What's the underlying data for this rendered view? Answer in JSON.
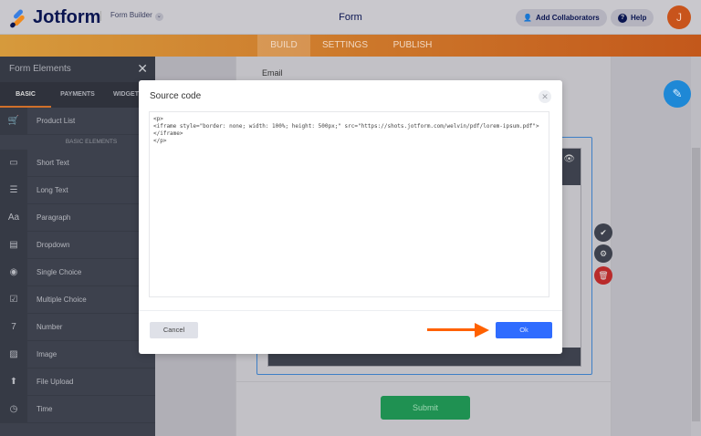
{
  "header": {
    "logo": "Jotform",
    "builder": "Form Builder",
    "title": "Form",
    "add_collaborators": "Add Collaborators",
    "help": "Help",
    "avatar": "J"
  },
  "nav": {
    "tabs": [
      "BUILD",
      "SETTINGS",
      "PUBLISH"
    ]
  },
  "sidebar": {
    "title": "Form Elements",
    "tabs": [
      "BASIC",
      "PAYMENTS",
      "WIDGETS"
    ],
    "product": {
      "label": "Product List",
      "icon": "🛒"
    },
    "section": "BASIC ELEMENTS",
    "items": [
      {
        "label": "Short Text",
        "icon": "▭"
      },
      {
        "label": "Long Text",
        "icon": "☰"
      },
      {
        "label": "Paragraph",
        "icon": "Aa"
      },
      {
        "label": "Dropdown",
        "icon": "▤"
      },
      {
        "label": "Single Choice",
        "icon": "◉"
      },
      {
        "label": "Multiple Choice",
        "icon": "☑"
      },
      {
        "label": "Number",
        "icon": "7"
      },
      {
        "label": "Image",
        "icon": "▨"
      },
      {
        "label": "File Upload",
        "icon": "⬆"
      },
      {
        "label": "Time",
        "icon": "◷"
      }
    ]
  },
  "form": {
    "email_label": "Email",
    "submit": "Submit"
  },
  "modal": {
    "title": "Source code",
    "code": "<p>\n<iframe style=\"border: none; width: 100%; height: 500px;\" src=\"https://shots.jotform.com/welvin/pdf/lorem-ipsum.pdf\"></iframe>\n</p>",
    "cancel": "Cancel",
    "ok": "Ok"
  },
  "colors": {
    "accent": "#2f6cff",
    "orange": "#ff6100",
    "submit": "#1f9152",
    "delete": "#b92b2b"
  }
}
